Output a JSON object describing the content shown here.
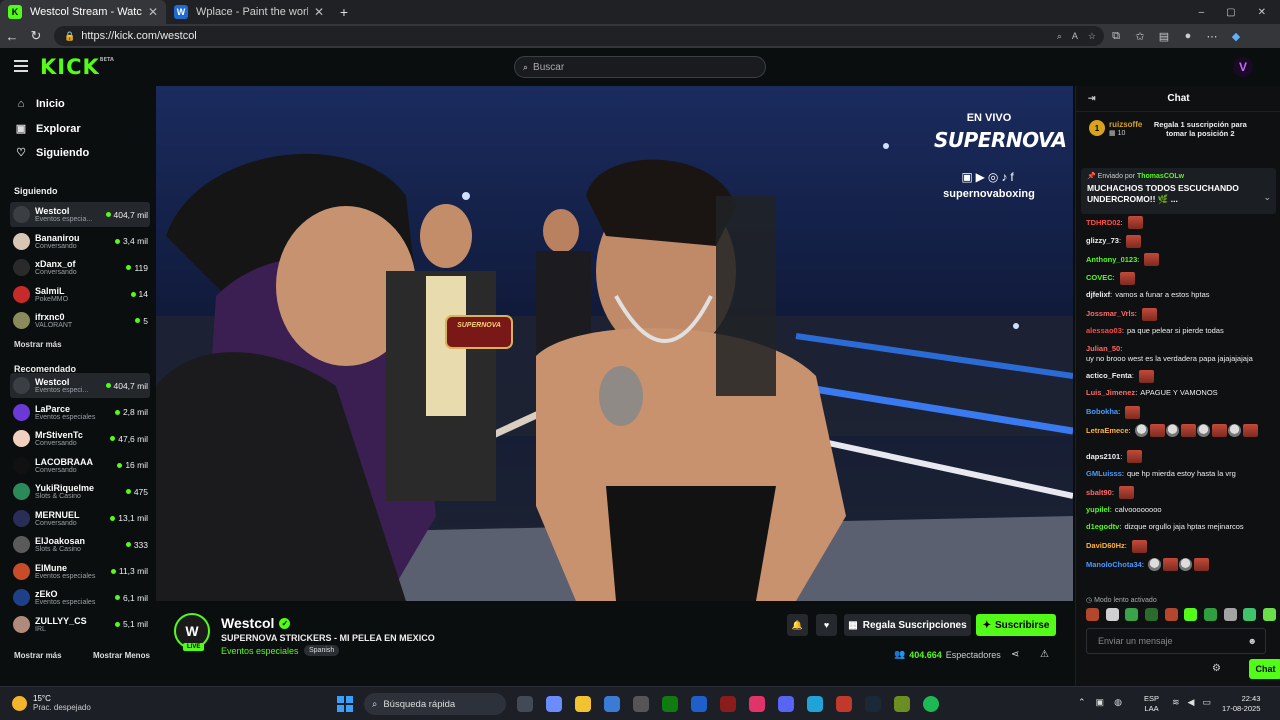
{
  "browser": {
    "tabs": [
      {
        "title": "Westcol Stream - Watch Live",
        "favicon": "K",
        "active": true
      },
      {
        "title": "Wplace - Paint the world",
        "favicon": "W",
        "active": false
      }
    ],
    "url": "https://kick.com/westcol"
  },
  "header": {
    "logo": "KICK",
    "logo_tag": "BETA",
    "search_placeholder": "Buscar"
  },
  "nav": {
    "inicio": "Inicio",
    "explorar": "Explorar",
    "siguiendo": "Siguiendo"
  },
  "sidebar": {
    "following_title": "Siguiendo",
    "following": [
      {
        "name": "Westcol",
        "category": "Eventos especia...",
        "viewers": "404,7 mil",
        "color": "#3b3f44"
      },
      {
        "name": "Bananirou",
        "category": "Conversando",
        "viewers": "3,4 mil",
        "color": "#d8c6b5"
      },
      {
        "name": "xDanx_of",
        "category": "Conversando",
        "viewers": "119",
        "color": "#2a2a2a"
      },
      {
        "name": "SalmiL",
        "category": "PokeMMO",
        "viewers": "14",
        "color": "#c62a2a"
      },
      {
        "name": "ifrxnc0",
        "category": "VALORANT",
        "viewers": "5",
        "color": "#8a8a5a"
      }
    ],
    "show_more": "Mostrar más",
    "recommended_title": "Recomendado",
    "recommended": [
      {
        "name": "Westcol",
        "category": "Eventos especi...",
        "viewers": "404,7 mil",
        "color": "#3b3f44"
      },
      {
        "name": "LaParce",
        "category": "Eventos especiales",
        "viewers": "2,8 mil",
        "color": "#6b3ad6"
      },
      {
        "name": "MrStivenTc",
        "category": "Conversando",
        "viewers": "47,6 mil",
        "color": "#f0d0c0"
      },
      {
        "name": "LACOBRAAA",
        "category": "Conversando",
        "viewers": "16 mil",
        "color": "#111111"
      },
      {
        "name": "YukiRiquelme",
        "category": "Slots & Casino",
        "viewers": "475",
        "color": "#2b8a5a"
      },
      {
        "name": "MERNUEL",
        "category": "Conversando",
        "viewers": "13,1 mil",
        "color": "#2a2d55"
      },
      {
        "name": "ElJoakosan",
        "category": "Slots & Casino",
        "viewers": "333",
        "color": "#5a5a5a"
      },
      {
        "name": "ElMune",
        "category": "Eventos especiales",
        "viewers": "11,3 mil",
        "color": "#c84b2a"
      },
      {
        "name": "zEkO",
        "category": "Eventos especiales",
        "viewers": "6,1 mil",
        "color": "#1f3f8a"
      },
      {
        "name": "ZULLYY_CS",
        "category": "IRL",
        "viewers": "5,1 mil",
        "color": "#b08a7a"
      }
    ],
    "show_more2": "Mostrar más",
    "show_less": "Mostrar Menos"
  },
  "video": {
    "overlay_live": "EN VIVO",
    "overlay_brand": "SUPERNOVA",
    "overlay_socials": "▣▶◎♪f",
    "overlay_handle": "supernovaboxing",
    "belt_text": "SUPERNOVA"
  },
  "stream": {
    "channel": "Westcol",
    "live_badge": "LIVE",
    "title": "SUPERNOVA STRICKERS - MI PELEA EN MEXICO",
    "category": "Eventos especiales",
    "language": "Spanish",
    "gift_label": "Regala Suscripciones",
    "subscribe_label": "Suscribirse",
    "viewers": "404.664",
    "viewers_label": "Espectadores"
  },
  "chat": {
    "title": "Chat",
    "gifter": {
      "rank": "1",
      "user": "ruizsoffe",
      "count": "10",
      "message": "Regala 1 suscripción para tomar la posición 2"
    },
    "pinned": {
      "sent_by": "Enviado por",
      "user": "ThomasCOLw",
      "message": "MUCHACHOS TODOS ESCUCHANDO UNDERCROMO!! 🌿 ..."
    },
    "messages": [
      {
        "user": "TDHRD02",
        "text": "",
        "color": "#ff4a4a",
        "emotes": 1
      },
      {
        "user": "glizzy_73",
        "text": "",
        "color": "#eeeeee",
        "emotes": 1
      },
      {
        "user": "Anthony_0123",
        "text": "",
        "color": "#53fc18",
        "emotes": 1
      },
      {
        "user": "COVEC",
        "text": "",
        "color": "#53fc18",
        "emotes": 1
      },
      {
        "user": "djfelixf",
        "text": "vamos a funar a estos hptas",
        "color": "#eeeeee",
        "emotes": 0
      },
      {
        "user": "Jossmar_Vrls",
        "text": "",
        "color": "#ff6a6a",
        "emotes": 1
      },
      {
        "user": "alessao03",
        "text": "pa que pelear si pierde todas",
        "color": "#ff4a4a",
        "emotes": 0
      },
      {
        "user": "Julian_50",
        "text": "uy no brooo west es la verdadera papa jajajajajaja",
        "color": "#ff6a6a",
        "emotes": 0
      },
      {
        "user": "actico_Fenta",
        "text": "",
        "color": "#eeeeee",
        "emotes": 1
      },
      {
        "user": "Luis_Jimenez",
        "text": "APAGUE Y VAMONOS",
        "color": "#ff6a6a",
        "emotes": 0
      },
      {
        "user": "Bobokha",
        "text": "",
        "color": "#4a9aff",
        "emotes": 1
      },
      {
        "user": "LetraEmece",
        "text": "",
        "color": "#ffb23a",
        "emotes": 8
      },
      {
        "user": "daps2101",
        "text": "",
        "color": "#eeeeee",
        "emotes": 1
      },
      {
        "user": "GMLuisss",
        "text": "que hp mierda estoy hasta la vrg",
        "color": "#4a9aff",
        "emotes": 0
      },
      {
        "user": "sbalt90",
        "text": "",
        "color": "#ff6a6a",
        "emotes": 1
      },
      {
        "user": "yupilel",
        "text": "calvoooooooo",
        "color": "#53fc18",
        "emotes": 0
      },
      {
        "user": "d1egodtv",
        "text": "dizque orgullo jaja hptas mejinarcos",
        "color": "#53fc18",
        "emotes": 0
      },
      {
        "user": "DaviD60Hz",
        "text": "",
        "color": "#ffb23a",
        "emotes": 1
      },
      {
        "user": "ManoloChota34",
        "text": "",
        "color": "#4a9aff",
        "emotes": 4
      }
    ],
    "slow_mode": "Modo lento activado",
    "input_placeholder": "Enviar un mensaje",
    "send_label": "Chat"
  },
  "taskbar": {
    "temp": "15°C",
    "weather": "Prac. despejado",
    "search": "Búsqueda rápida",
    "lang1": "ESP",
    "lang2": "LAA",
    "time": "22:43",
    "date": "17-08-2025"
  }
}
